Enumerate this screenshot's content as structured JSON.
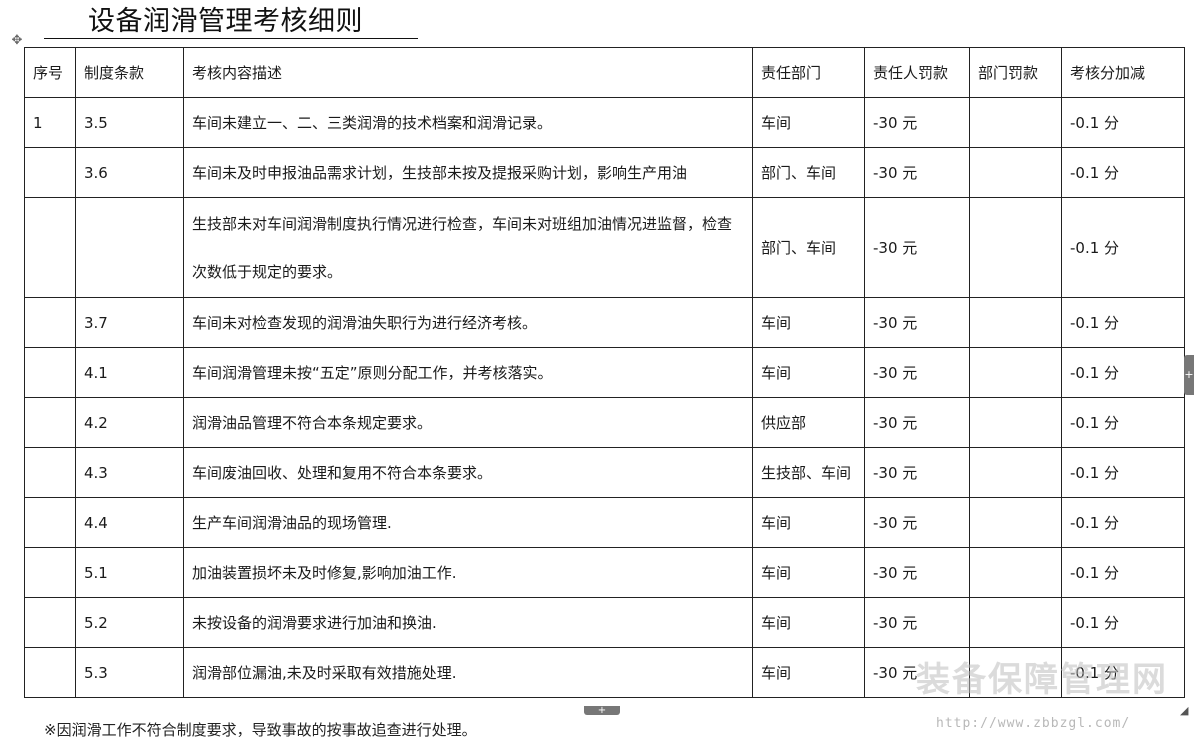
{
  "document": {
    "title": "设备润滑管理考核细则",
    "footnote": "※因润滑工作不符合制度要求，导致事故的按事故追查进行处理。"
  },
  "table": {
    "headers": [
      "序号",
      "制度条款",
      "考核内容描述",
      "责任部门",
      "责任人罚款",
      "部门罚款",
      "考核分加减"
    ],
    "rows": [
      {
        "seq": "1",
        "clause": "3.5",
        "desc": "车间未建立一、二、三类润滑的技术档案和润滑记录。",
        "dept": "车间",
        "person_fine": "-30 元",
        "dept_fine": "",
        "score": "-0.1 分"
      },
      {
        "seq": "",
        "clause": "3.6",
        "desc": "车间未及时申报油品需求计划，生技部未按及提报采购计划，影响生产用油",
        "dept": "部门、车间",
        "person_fine": "-30 元",
        "dept_fine": "",
        "score": "-0.1 分"
      },
      {
        "seq": "",
        "clause": "",
        "desc": "生技部未对车间润滑制度执行情况进行检查，车间未对班组加油情况进监督，检查次数低于规定的要求。",
        "dept": "部门、车间",
        "person_fine": "-30 元",
        "dept_fine": "",
        "score": "-0.1 分"
      },
      {
        "seq": "",
        "clause": "3.7",
        "desc": "车间未对检查发现的润滑油失职行为进行经济考核。",
        "dept": "车间",
        "person_fine": "-30 元",
        "dept_fine": "",
        "score": "-0.1 分"
      },
      {
        "seq": "",
        "clause": "4.1",
        "desc": "车间润滑管理未按“五定”原则分配工作，并考核落实。",
        "dept": "车间",
        "person_fine": "-30 元",
        "dept_fine": "",
        "score": "-0.1 分"
      },
      {
        "seq": "",
        "clause": "4.2",
        "desc": "润滑油品管理不符合本条规定要求。",
        "dept": "供应部",
        "person_fine": "-30 元",
        "dept_fine": "",
        "score": "-0.1 分"
      },
      {
        "seq": "",
        "clause": "4.3",
        "desc": "车间废油回收、处理和复用不符合本条要求。",
        "dept": "生技部、车间",
        "person_fine": "-30 元",
        "dept_fine": "",
        "score": "-0.1 分"
      },
      {
        "seq": "",
        "clause": "4.4",
        "desc": "生产车间润滑油品的现场管理.",
        "dept": "车间",
        "person_fine": "-30 元",
        "dept_fine": "",
        "score": "-0.1 分"
      },
      {
        "seq": "",
        "clause": "5.1",
        "desc": "加油装置损坏未及时修复,影响加油工作.",
        "dept": "车间",
        "person_fine": "-30 元",
        "dept_fine": "",
        "score": "-0.1 分"
      },
      {
        "seq": "",
        "clause": "5.2",
        "desc": "未按设备的润滑要求进行加油和换油.",
        "dept": "车间",
        "person_fine": "-30 元",
        "dept_fine": "",
        "score": "-0.1 分"
      },
      {
        "seq": "",
        "clause": "5.3",
        "desc": "润滑部位漏油,未及时采取有效措施处理.",
        "dept": "车间",
        "person_fine": "-30 元",
        "dept_fine": "",
        "score": "-0.1 分"
      }
    ]
  },
  "watermark": {
    "text": "装备保障管理网",
    "url": "http://www.zbbzgl.com/"
  },
  "icons": {
    "move_handle": "move-icon",
    "side_handle": "add-column-icon",
    "bottom_handle": "add-row-icon",
    "resize": "resize-icon"
  }
}
